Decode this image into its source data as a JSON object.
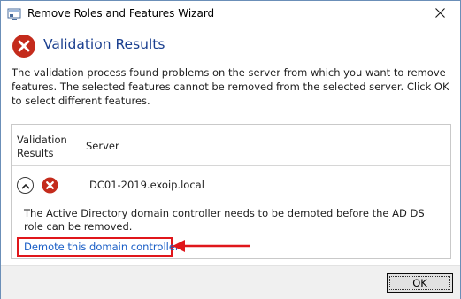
{
  "window": {
    "title": "Remove Roles and Features Wizard"
  },
  "header": {
    "heading": "Validation Results",
    "icon": "error-icon"
  },
  "description": "The validation process found problems on the server from which you want to remove features. The selected features cannot be removed from the selected server.  Click OK to select different features.",
  "table": {
    "columns": [
      "Validation Results",
      "Server"
    ],
    "rows": [
      {
        "status_icon": "error-icon",
        "server": "DC01-2019.exoip.local",
        "message": "The Active Directory domain controller needs to be demoted before the AD DS role can be removed.",
        "link": "Demote this domain controller"
      }
    ]
  },
  "footer": {
    "ok_label": "OK"
  },
  "colors": {
    "heading": "#1a3f8f",
    "error": "#c42b1c",
    "link": "#1a5ec6",
    "highlight": "#e0161b"
  }
}
